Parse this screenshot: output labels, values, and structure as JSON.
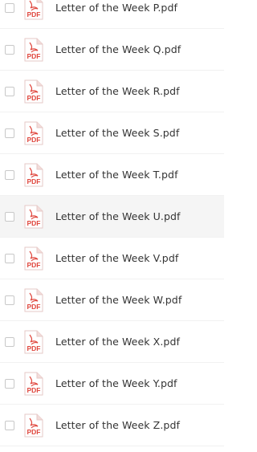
{
  "colors": {
    "pdf_red": "#e0483f",
    "text": "#333333",
    "highlight": "#f5f5f5"
  },
  "icon": "pdf-file-icon",
  "files": [
    {
      "name": "Letter of the Week P.pdf",
      "badge": "PDF"
    },
    {
      "name": "Letter of the Week Q.pdf",
      "badge": "PDF"
    },
    {
      "name": "Letter of the Week R.pdf",
      "badge": "PDF"
    },
    {
      "name": "Letter of the Week S.pdf",
      "badge": "PDF"
    },
    {
      "name": "Letter of the Week T.pdf",
      "badge": "PDF"
    },
    {
      "name": "Letter of the Week U.pdf",
      "badge": "PDF",
      "hovered": true
    },
    {
      "name": "Letter of the Week V.pdf",
      "badge": "PDF"
    },
    {
      "name": "Letter of the Week W.pdf",
      "badge": "PDF"
    },
    {
      "name": "Letter of the Week X.pdf",
      "badge": "PDF"
    },
    {
      "name": "Letter of the Week Y.pdf",
      "badge": "PDF"
    },
    {
      "name": "Letter of the Week Z.pdf",
      "badge": "PDF"
    }
  ]
}
